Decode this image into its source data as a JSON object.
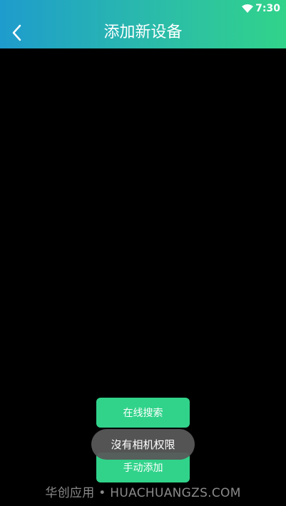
{
  "status_bar": {
    "time": "7:30",
    "wifi_icon": "wifi-icon"
  },
  "header": {
    "back_icon": "chevron-left-icon",
    "title": "添加新设备"
  },
  "buttons": {
    "online_search": "在线搜索",
    "manual_add": "手动添加"
  },
  "toast": {
    "message": "沒有相机权限"
  },
  "watermark": {
    "text": "华创应用 • HUACHUANGZS.COM"
  },
  "colors": {
    "gradient_start": "#1e9ccd",
    "gradient_end": "#31d38a",
    "button_green": "#31d38a",
    "toast_bg": "#585858"
  }
}
